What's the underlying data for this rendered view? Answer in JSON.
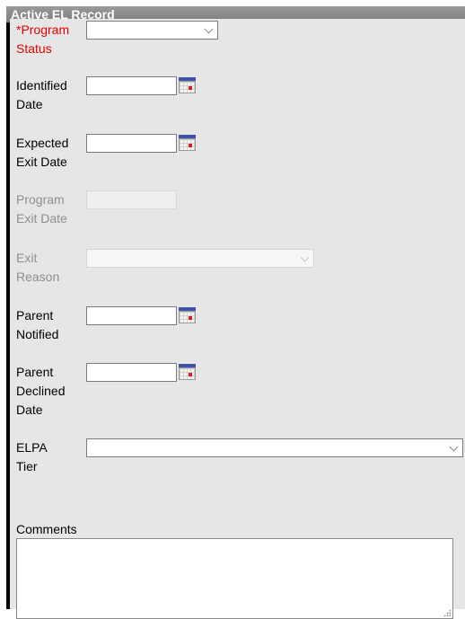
{
  "panel": {
    "title": "Active EL Record"
  },
  "fields": {
    "program_status": {
      "label_line1": "*Program",
      "label_line2": "Status",
      "value": ""
    },
    "identified_date": {
      "label_line1": "Identified",
      "label_line2": "Date",
      "value": ""
    },
    "expected_exit_date": {
      "label_line1": "Expected",
      "label_line2": "Exit Date",
      "value": ""
    },
    "program_exit_date": {
      "label_line1": "Program",
      "label_line2": "Exit Date",
      "value": ""
    },
    "exit_reason": {
      "label_line1": "Exit",
      "label_line2": "Reason",
      "value": ""
    },
    "parent_notified": {
      "label_line1": "Parent",
      "label_line2": "Notified",
      "value": ""
    },
    "parent_declined_date": {
      "label_line1": "Parent",
      "label_line2": "Declined",
      "label_line3": "Date",
      "value": ""
    },
    "elpa_tier": {
      "label_line1": "ELPA",
      "label_line2": "Tier",
      "value": ""
    },
    "comments": {
      "label": "Comments",
      "value": ""
    }
  },
  "icons": {
    "calendar": "calendar-icon",
    "dropdown": "chevron-down-icon",
    "resize": "resize-grip-icon"
  },
  "colors": {
    "required_label": "#e00000",
    "disabled_label": "#8e8e8e",
    "panel_background": "#e6e6e6",
    "header_background": "#8a8a8a"
  }
}
